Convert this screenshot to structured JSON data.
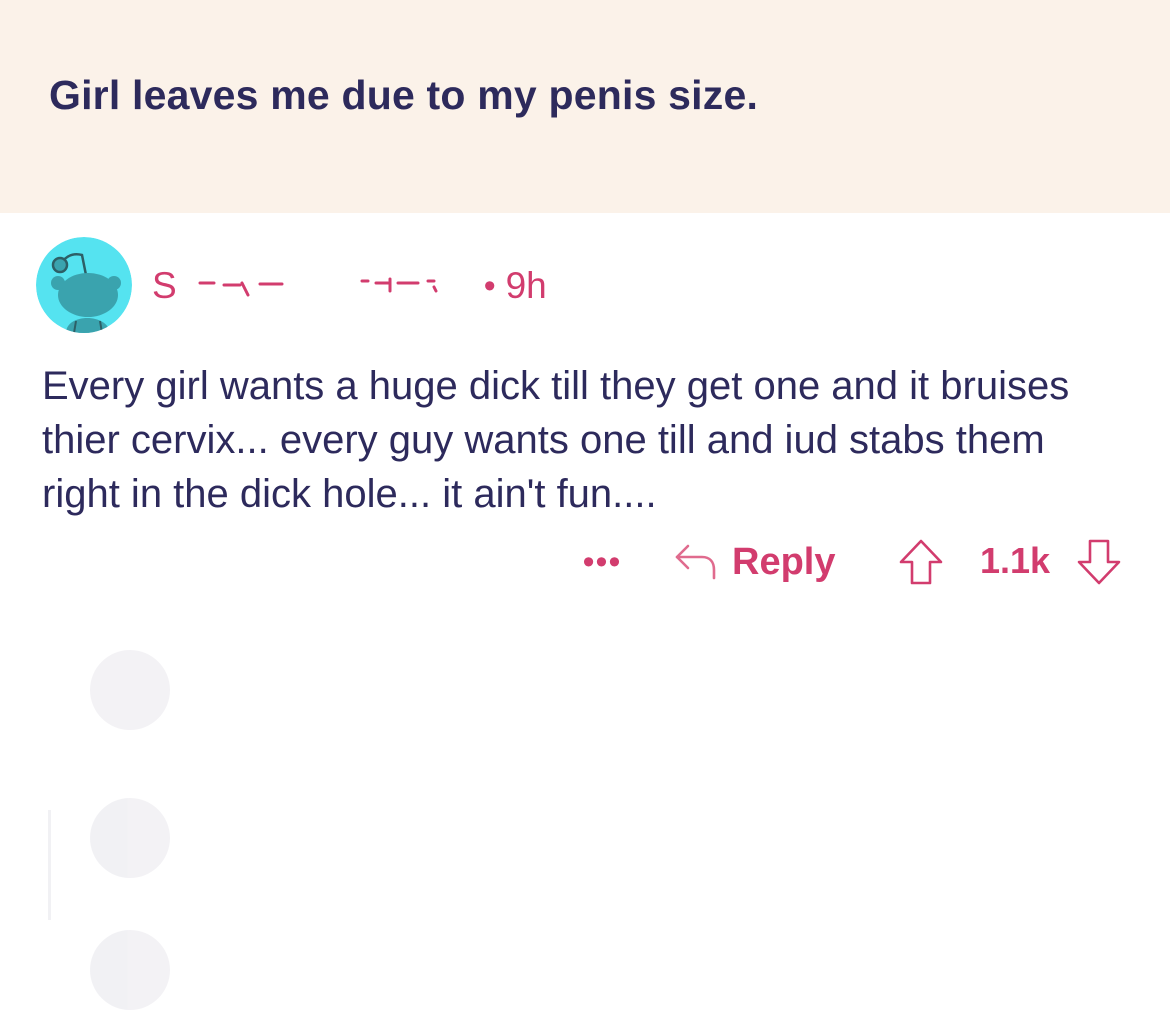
{
  "post": {
    "title": "Girl leaves me due to my penis size."
  },
  "comment": {
    "author_visible_prefix": "S",
    "separator": "•",
    "age": "9h",
    "body": "Every girl wants a huge dick till they get one and it bruises thier cervix... every guy wants one till and iud stabs them right in the dick hole... it ain't fun....",
    "actions": {
      "more_label": "•••",
      "reply_label": "Reply",
      "vote_count": "1.1k"
    }
  },
  "colors": {
    "header_bg": "#fbf2e9",
    "title_text": "#2d2a5c",
    "accent": "#d23c6e",
    "avatar_bg": "#55e3f0",
    "avatar_figure": "#3aa3ae"
  },
  "icons": {
    "avatar": "snoo-avatar-icon",
    "reply": "reply-arrow-icon",
    "upvote": "upvote-arrow-icon",
    "downvote": "downvote-arrow-icon"
  }
}
